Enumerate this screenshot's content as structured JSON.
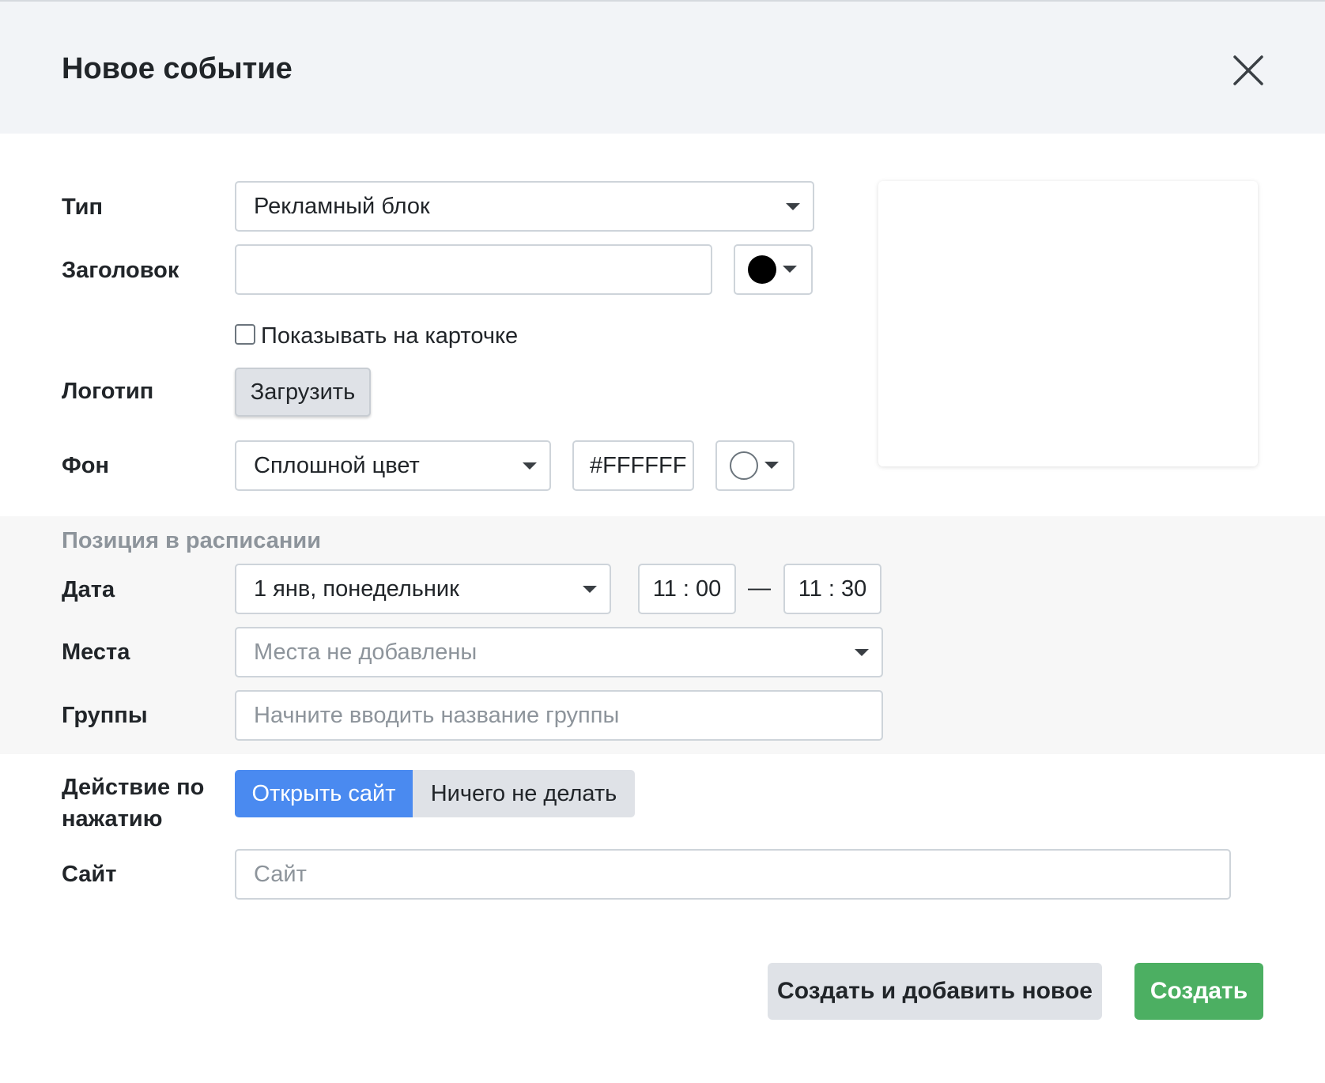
{
  "modal": {
    "title": "Новое событие",
    "close_icon": "close-icon"
  },
  "form": {
    "type": {
      "label": "Тип",
      "value": "Рекламный блок"
    },
    "heading": {
      "label": "Заголовок",
      "value": "",
      "color": "#000000"
    },
    "show_on_card": {
      "label": "Показывать на карточке",
      "checked": false
    },
    "logo": {
      "label": "Логотип",
      "button": "Загрузить"
    },
    "background": {
      "label": "Фон",
      "mode": "Сплошной цвет",
      "hex": "#FFFFFF",
      "color": "#FFFFFF"
    }
  },
  "schedule": {
    "section_title": "Позиция в расписании",
    "date": {
      "label": "Дата",
      "value": "1 янв, понедельник"
    },
    "time_start": "11 : 00",
    "time_separator": "—",
    "time_end": "11 : 30",
    "places": {
      "label": "Места",
      "placeholder": "Места не добавлены"
    },
    "groups": {
      "label": "Группы",
      "placeholder": "Начните вводить название группы"
    }
  },
  "action": {
    "label_line1": "Действие по",
    "label_line2": "нажатию",
    "options": [
      "Открыть сайт",
      "Ничего не делать"
    ],
    "selected": "Открыть сайт"
  },
  "site": {
    "label": "Сайт",
    "placeholder": "Сайт"
  },
  "footer": {
    "create_and_add": "Создать и добавить новое",
    "create": "Создать"
  },
  "colors": {
    "header_bg": "#f2f4f7",
    "accent_blue": "#4a8af0",
    "success_green": "#4caf62"
  }
}
